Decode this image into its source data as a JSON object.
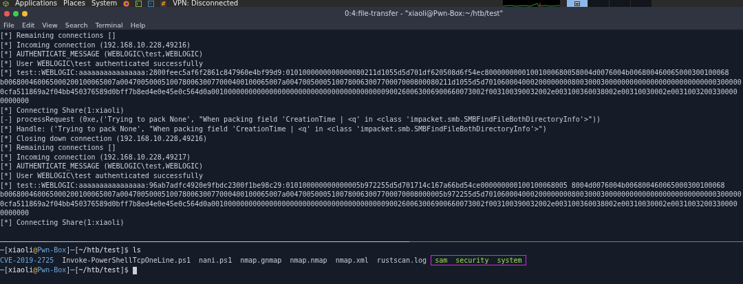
{
  "top_panel": {
    "menus": [
      "Applications",
      "Places",
      "System"
    ],
    "vpn_status": "VPN: Disconnected",
    "workspaces": [
      {
        "selected": true
      },
      {
        "selected": false
      },
      {
        "selected": false
      },
      {
        "selected": false
      }
    ]
  },
  "window": {
    "title": "0:4:file-transfer - \"xiaoli@Pwn-Box:~/htb/test\"",
    "menu": [
      "File",
      "Edit",
      "View",
      "Search",
      "Terminal",
      "Help"
    ]
  },
  "output_lines": [
    "[*] Remaining connections []",
    "[*] Incoming connection (192.168.10.228,49216)",
    "[*] AUTHENTICATE_MESSAGE (WEBLOGIC\\test,WEBLOGIC)",
    "[*] User WEBLOGIC\\test authenticated successfully",
    "[*] test::WEBLOGIC:aaaaaaaaaaaaaaaa:2800feec5af6f2861c847960e4bf99d9:0101000000000000080211d1055d5d701df620508d6f54ec80000000001001000680058004d0076004b006800460065000300100068",
    "b006800460065000200100065007a004700500051007800630077000400100065007a0047005000510078006300770007000800080211d1055d5d70106000400020000000080030003000000000000000000000000000300000",
    "0cfa511869a2f04bb450376589d0bff7b8ed4e0e45e0c564d0a001000000000000000000000000000000000000000900260063006900660073002f003100390032002e003100360038002e00310030002e0031003200330000",
    "0000000",
    "[*] Connecting Share(1:xiaoli)",
    "[-] processRequest (0xe,('Trying to pack None', \"When packing field 'CreationTime | <q' in <class 'impacket.smb.SMBFindFileBothDirectoryInfo'>\"))",
    "[*] Handle: ('Trying to pack None', \"When packing field 'CreationTime | <q' in <class 'impacket.smb.SMBFindFileBothDirectoryInfo'>\")",
    "[*] Closing down connection (192.168.10.228,49216)",
    "[*] Remaining connections []",
    "[*] Incoming connection (192.168.10.228,49217)",
    "[*] AUTHENTICATE_MESSAGE (WEBLOGIC\\test,WEBLOGIC)",
    "[*] User WEBLOGIC\\test authenticated successfully",
    "[*] test::WEBLOGIC:aaaaaaaaaaaaaaaa:96ab7adfc4920e9fbdc2300f1be98c29:010100000000000005b972255d5d701714c167a66bd54ce000000000100100068005 8004d0076004b006800460065000300100068",
    "b006800460065000200100065007a004700500051007800630077000400100065007a00470050005100780063007700070008000005b972255d5d70106000400020000000080030003000000000000000000000000000300000",
    "0cfa511869a2f04bb450376589d0bff7b8ed4e0e45e0c564d0a001000000000000000000000000000000000000000900260063006900660073002f003100390032002e003100360038002e00310030002e0031003200330000",
    "0000000",
    "[*] Connecting Share(1:xiaoli)"
  ],
  "shell": [
    {
      "kind": "prompt",
      "segments": [
        {
          "text": "─[",
          "kind": "frame"
        },
        {
          "text": "xiaoli",
          "kind": "user"
        },
        {
          "text": "@",
          "kind": "at"
        },
        {
          "text": "Pwn-Box",
          "kind": "host"
        },
        {
          "text": "]─[",
          "kind": "frame"
        },
        {
          "text": "~/htb/test",
          "kind": "path"
        },
        {
          "text": "]$ ",
          "kind": "frame"
        },
        {
          "text": "ls",
          "kind": "command"
        }
      ]
    },
    {
      "kind": "listing",
      "entries": [
        {
          "name": "CVE-2019-2725",
          "kind": "directory",
          "highlighted": false
        },
        {
          "name": "Invoke-PowerShellTcpOneLine.ps1",
          "kind": "file",
          "highlighted": false
        },
        {
          "name": "nani.ps1",
          "kind": "file",
          "highlighted": false
        },
        {
          "name": "nmap.gnmap",
          "kind": "file",
          "highlighted": false
        },
        {
          "name": "nmap.nmap",
          "kind": "file",
          "highlighted": false
        },
        {
          "name": "nmap.xml",
          "kind": "file",
          "highlighted": false
        },
        {
          "name": "rustscan.log",
          "kind": "file",
          "highlighted": false
        },
        {
          "name": "sam",
          "kind": "executable",
          "highlighted": true
        },
        {
          "name": "security",
          "kind": "executable",
          "highlighted": true
        },
        {
          "name": "system",
          "kind": "executable",
          "highlighted": true
        }
      ]
    },
    {
      "kind": "prompt",
      "cursor": true,
      "segments": [
        {
          "text": "─[",
          "kind": "frame"
        },
        {
          "text": "xiaoli",
          "kind": "user"
        },
        {
          "text": "@",
          "kind": "at"
        },
        {
          "text": "Pwn-Box",
          "kind": "host"
        },
        {
          "text": "]─[",
          "kind": "frame"
        },
        {
          "text": "~/htb/test",
          "kind": "path"
        },
        {
          "text": "]$ ",
          "kind": "frame"
        }
      ]
    }
  ]
}
